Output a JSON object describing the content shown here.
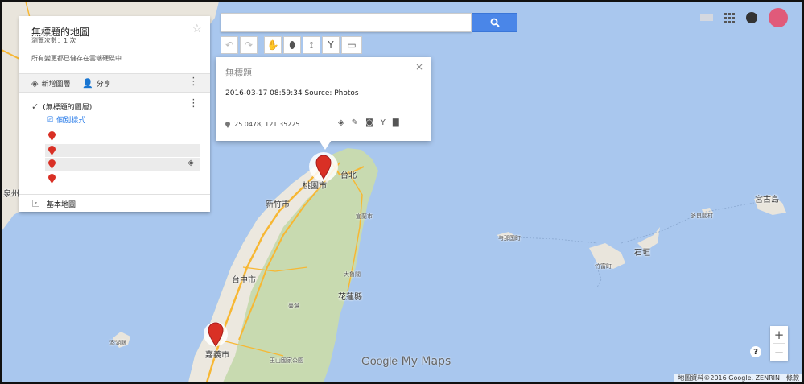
{
  "map": {
    "labels": {
      "taoyuan": "桃園市",
      "taipei": "台北",
      "hsinchu": "新竹市",
      "yilan": "宜蘭市",
      "taichung": "台中市",
      "hualien": "花蓮縣",
      "taitung": "臺灣",
      "chiayi": "嘉義市",
      "penghu": "澎湖縣",
      "miyakojima": "宮古島",
      "tarama": "多良間村",
      "yonaguni": "与那国町",
      "ishigaki": "石垣",
      "taketomi": "竹富町",
      "quanzhou": "泉州",
      "yushan": "玉山國家公園",
      "taroko": "大魯閣"
    },
    "pins": [
      "taoyuan-pin",
      "chiayi-pin"
    ],
    "colors": {
      "water": "#a9c7ee",
      "land": "#e9e5dc",
      "forest": "#c8dab0",
      "road": "#f7b733",
      "pin": "#d93025"
    }
  },
  "search": {
    "value": "",
    "placeholder": ""
  },
  "toolbar": [
    "undo",
    "redo",
    "pan",
    "add-marker",
    "draw-line",
    "directions",
    "measure"
  ],
  "panel": {
    "title": "無標題的地圖",
    "views": "瀏覽次數：1 次",
    "saved": "所有變更都已儲存在雲端硬碟中",
    "add_layer": "新增圖層",
    "share": "分享",
    "layer_name": "(無標題的圖層)",
    "style": "個別樣式",
    "base_map": "基本地圖"
  },
  "popup": {
    "title": "無標題",
    "close": "×",
    "description": "2016-03-17 08:59:34 Source: Photos",
    "coords": "25.0478, 121.35225"
  },
  "branding": {
    "logo_google": "Google",
    "logo_product": "My Maps"
  },
  "zoom": {
    "in": "+",
    "out": "−",
    "help": "?"
  },
  "attribution": {
    "text": "地圖資料©2016 Google, ZENRIN",
    "terms": "條款"
  }
}
